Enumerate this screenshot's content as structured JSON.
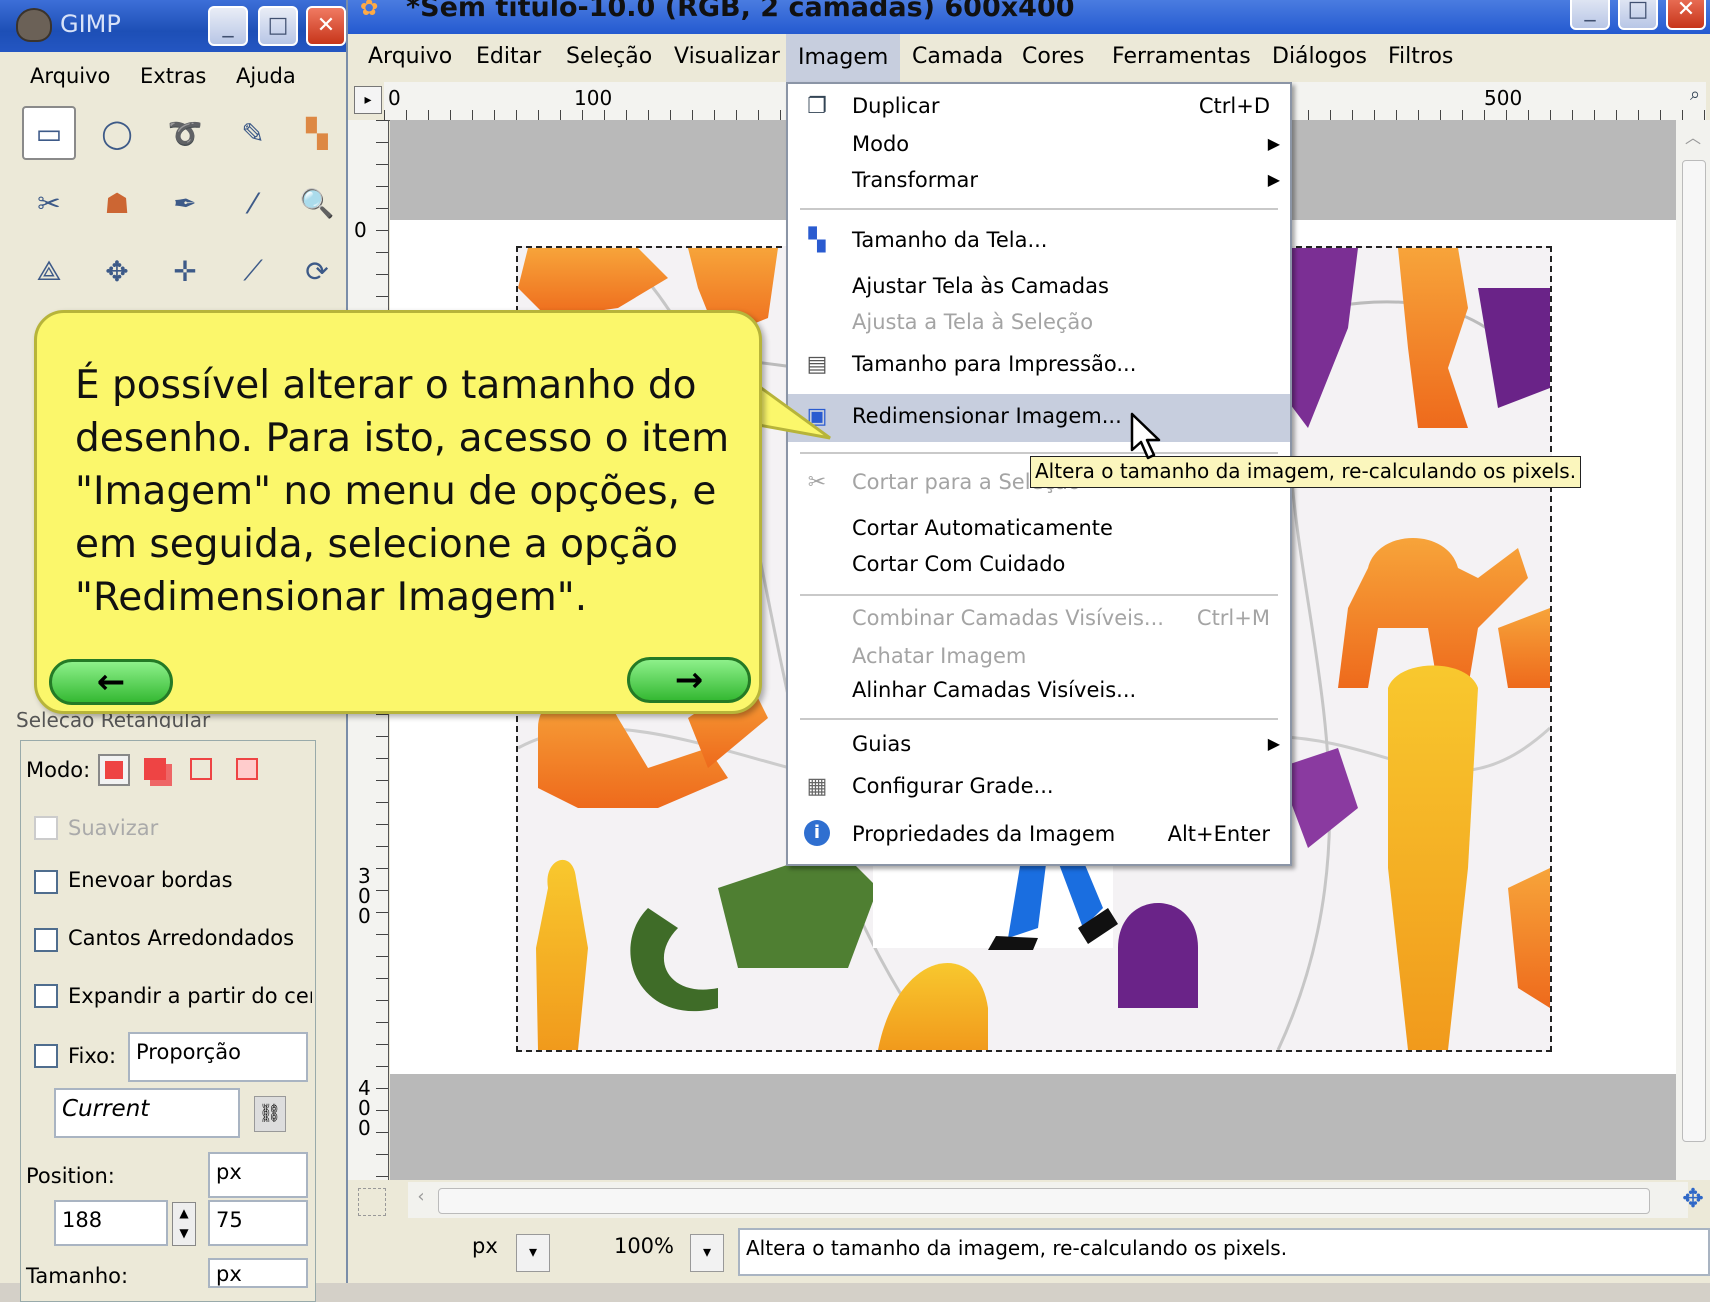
{
  "toolbox": {
    "title": "GIMP",
    "menu": [
      "Arquivo",
      "Extras",
      "Ajuda"
    ],
    "tool_options_title": "Seleção Retangular",
    "mode_label": "Modo:",
    "antialias_label": "Suavizar",
    "feather_label": "Enevoar bordas",
    "rounded_label": "Cantos Arredondados",
    "expand_label": "Expandir a partir do cer",
    "fixed_label": "Fixo:",
    "fixed_value": "Proporção",
    "current_value": "Current",
    "position_label": "Position:",
    "position_unit": "px",
    "position_x": "188",
    "position_y": "75",
    "size_label": "Tamanho:",
    "size_unit": "px"
  },
  "image_window": {
    "title": "*Sem título-10.0 (RGB, 2 camadas) 600x400",
    "menubar": [
      "Arquivo",
      "Editar",
      "Seleção",
      "Visualizar",
      "Imagem",
      "Camada",
      "Cores",
      "Ferramentas",
      "Diálogos",
      "Filtros"
    ],
    "ruler_top": [
      "0",
      "100",
      "500"
    ],
    "ruler_left": [
      "0",
      "3\n0\n0",
      "4\n0\n0"
    ],
    "unit": "px",
    "zoom": "100%",
    "status": "Altera o tamanho da imagem, re-calculando os pixels."
  },
  "imagem_menu": {
    "duplicar": {
      "label": "Duplicar",
      "shortcut": "Ctrl+D"
    },
    "modo": {
      "label": "Modo"
    },
    "transformar": {
      "label": "Transformar"
    },
    "tamanho_tela": {
      "label": "Tamanho da Tela..."
    },
    "ajustar_camadas": {
      "label": "Ajustar Tela às Camadas"
    },
    "ajusta_selecao": {
      "label": "Ajusta a Tela à Seleção"
    },
    "tamanho_impressao": {
      "label": "Tamanho para  Impressão..."
    },
    "redimensionar": {
      "label": "Redimensionar Imagem..."
    },
    "cortar_selecao": {
      "label": "Cortar para a Seleção"
    },
    "cortar_auto": {
      "label": "Cortar Automaticamente"
    },
    "cortar_cuidado": {
      "label": "Cortar Com Cuidado"
    },
    "combinar": {
      "label": "Combinar Camadas Visíveis...",
      "shortcut": "Ctrl+M"
    },
    "achatar": {
      "label": "Achatar Imagem"
    },
    "alinhar": {
      "label": "Alinhar Camadas Visíveis..."
    },
    "guias": {
      "label": "Guias"
    },
    "grade": {
      "label": "Configurar Grade..."
    },
    "propriedades": {
      "label": "Propriedades da Imagem",
      "shortcut": "Alt+Enter"
    }
  },
  "tooltip": "Altera o tamanho da imagem, re-calculando os pixels.",
  "callout": {
    "text": "É possível alterar o tamanho do desenho. Para isto, acesso o item \"Imagem\" no menu de opções, e em seguida, selecione a opção \"Redimensionar Imagem\".",
    "prev_icon": "left-arrow-icon",
    "next_icon": "right-arrow-icon"
  }
}
